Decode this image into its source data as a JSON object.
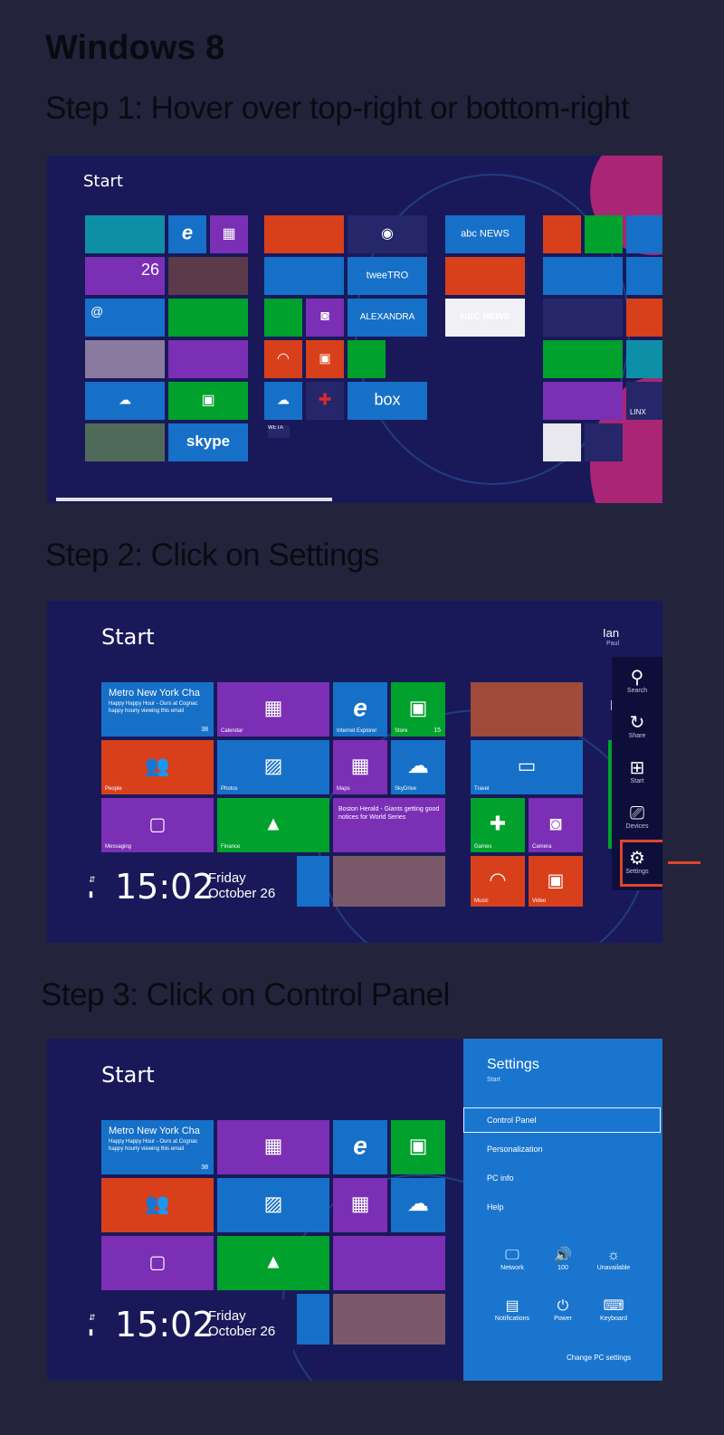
{
  "title": "Windows 8",
  "steps": [
    "Step 1: Hover over top-right or bottom-right",
    "Step 2: Click on Settings",
    "Step 3: Click on Control Panel"
  ],
  "shot1": {
    "start": "Start",
    "tiles": {
      "store": "",
      "date_num": "26",
      "twee": "tweeTRO",
      "alexandra": "ALEXANDRA",
      "abc": "abc NEWS",
      "nbc": "NBC NEWS",
      "skype": "skype",
      "box": "box",
      "linx": "LINX",
      "weta": "WETA"
    }
  },
  "shot2": {
    "start": "Start",
    "user": "Ian",
    "user_sub": "Paul",
    "la": "La",
    "mail_title": "Metro New York Cha",
    "mail_text": "Happy Happy Hour - Ours at Cognac happy hourly viewing this email",
    "mail_count": "38",
    "tile_labels": {
      "calendar": "Calendar",
      "ie": "Internet Explorer",
      "store": "Store",
      "store_count": "15",
      "people": "People",
      "photos": "Photos",
      "maps": "Maps",
      "skydrive": "SkyDrive",
      "travel": "Travel",
      "messaging": "Messaging",
      "finance": "Finance",
      "news_text": "Boston Herald - Giants getting good notices for World Series",
      "games": "Games",
      "camera": "Camera",
      "music": "Music",
      "video": "Video"
    },
    "time": "15:02",
    "day": "Friday",
    "date": "October 26",
    "charms": {
      "search": "Search",
      "share": "Share",
      "start": "Start",
      "devices": "Devices",
      "settings": "Settings"
    }
  },
  "shot3": {
    "start": "Start",
    "mail_title": "Metro New York Cha",
    "mail_text": "Happy Happy Hour - Ours at Cognac happy hourly viewing this email",
    "mail_count": "38",
    "time": "15:02",
    "day": "Friday",
    "date": "October 26",
    "pane": {
      "title": "Settings",
      "sub": "Start",
      "items": [
        "Control Panel",
        "Personalization",
        "PC info",
        "Help"
      ],
      "quick": [
        {
          "label": "Network",
          "icon": "network-icon"
        },
        {
          "label": "100",
          "icon": "volume-icon"
        },
        {
          "label": "Unavailable",
          "icon": "brightness-icon"
        },
        {
          "label": "Notifications",
          "icon": "notifications-icon"
        },
        {
          "label": "Power",
          "icon": "power-icon"
        },
        {
          "label": "Keyboard",
          "icon": "keyboard-icon"
        }
      ],
      "change": "Change PC settings"
    }
  },
  "colors": {
    "background": "#23233c",
    "start_bg": "#19195a",
    "highlight": "#e0452a",
    "settings_pane": "#1a75cf"
  }
}
